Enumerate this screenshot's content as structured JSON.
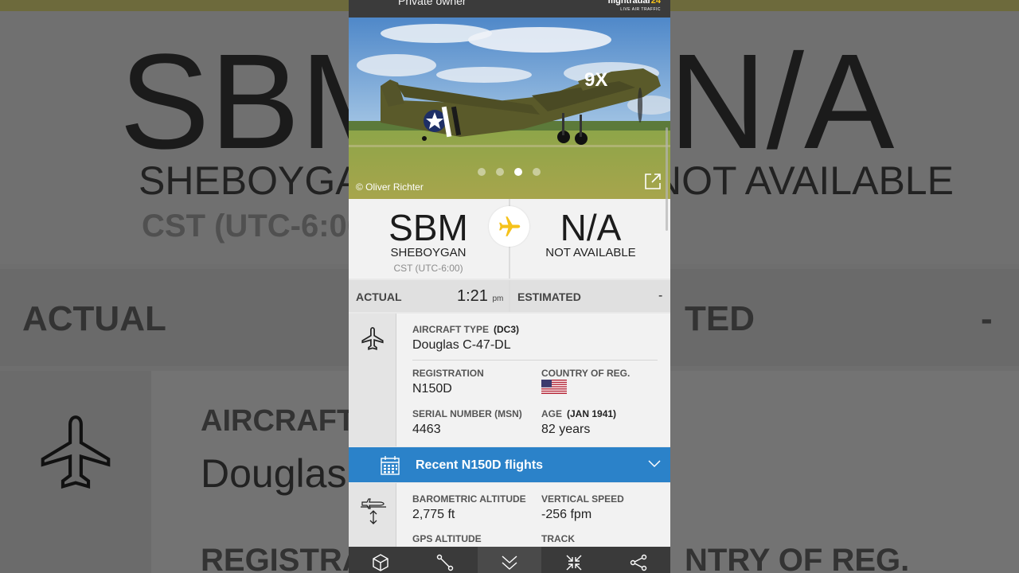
{
  "background": {
    "zoom_texts": [
      "SBM",
      "N/A",
      "SHEBOYGAN",
      "NOT AVAILABLE",
      "CST (UTC-6:00",
      "ACTUAL",
      "TED",
      "-",
      "AIRCRAFT",
      "Douglas",
      "REGISTRA",
      "NTRY OF REG."
    ]
  },
  "header": {
    "owner": "Private owner",
    "logo_main": "flightradar",
    "logo_num": "24",
    "logo_sub": "LIVE AIR TRAFFIC"
  },
  "photo": {
    "credit": "© Oliver Richter",
    "active_index": 2,
    "count": 4,
    "tail_text": "9X"
  },
  "route": {
    "origin": {
      "code": "SBM",
      "city": "SHEBOYGAN",
      "tz": "CST (UTC-6:00)"
    },
    "destination": {
      "code": "N/A",
      "city": "NOT AVAILABLE"
    }
  },
  "times": {
    "actual_label": "ACTUAL",
    "actual_value": "1:21",
    "actual_suffix": "pm",
    "estimated_label": "ESTIMATED",
    "estimated_value": "-"
  },
  "aircraft": {
    "type_label": "AIRCRAFT TYPE",
    "type_code": "(DC3)",
    "type_value": "Douglas C-47-DL",
    "registration_label": "REGISTRATION",
    "registration_value": "N150D",
    "country_label": "COUNTRY OF REG.",
    "serial_label": "SERIAL NUMBER (MSN)",
    "serial_value": "4463",
    "age_label": "AGE",
    "age_date": "(JAN 1941)",
    "age_value": "82 years"
  },
  "recent": {
    "label": "Recent N150D flights"
  },
  "altitude": {
    "baro_label": "BAROMETRIC ALTITUDE",
    "baro_value": "2,775 ft",
    "vspeed_label": "VERTICAL SPEED",
    "vspeed_value": "-256 fpm",
    "gps_label": "GPS ALTITUDE",
    "track_label": "TRACK"
  },
  "colors": {
    "accent_blue": "#2b82c9",
    "plane_yellow": "#f5c21b"
  },
  "bottom_icons": [
    "cube-icon",
    "route-icon",
    "chevron-double-down-icon",
    "collapse-icon",
    "share-icon"
  ]
}
